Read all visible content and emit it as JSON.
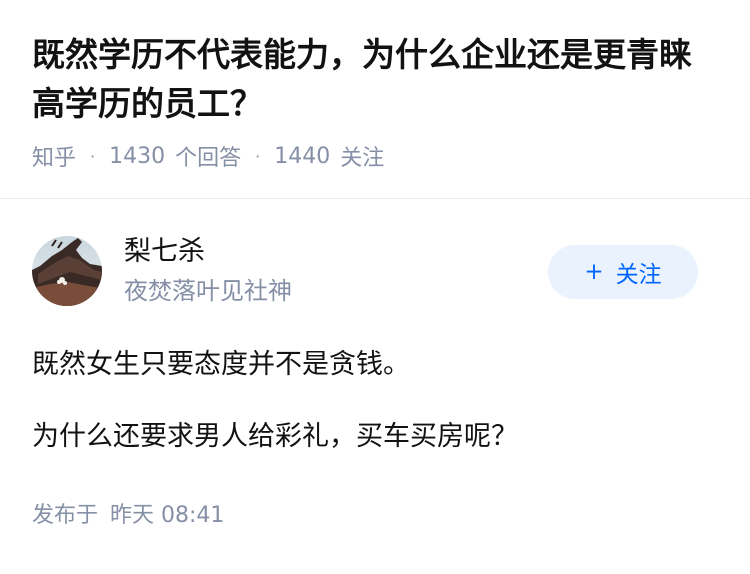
{
  "question": {
    "title": "既然学历不代表能力，为什么企业还是更青睐高学历的员工？",
    "source": "知乎",
    "answer_count": "1430",
    "answer_label": "个回答",
    "follower_count": "1440",
    "follower_label": "关注",
    "separator": "·"
  },
  "answer": {
    "author": {
      "name": "梨七杀",
      "bio": "夜焚落叶见社神",
      "avatar_icon": "avatar-image"
    },
    "follow_button": {
      "plus": "+",
      "label": "关注"
    },
    "paragraphs": [
      "既然女生只要态度并不是贪钱。",
      "为什么还要求男人给彩礼，买车买房呢？"
    ],
    "published": {
      "prefix": "发布于",
      "time": "昨天 08:41"
    }
  },
  "colors": {
    "primary_text": "#121212",
    "secondary_text": "#8590a6",
    "accent": "#0066ff",
    "follow_bg": "#eaf2fd",
    "divider": "#ebebeb"
  }
}
